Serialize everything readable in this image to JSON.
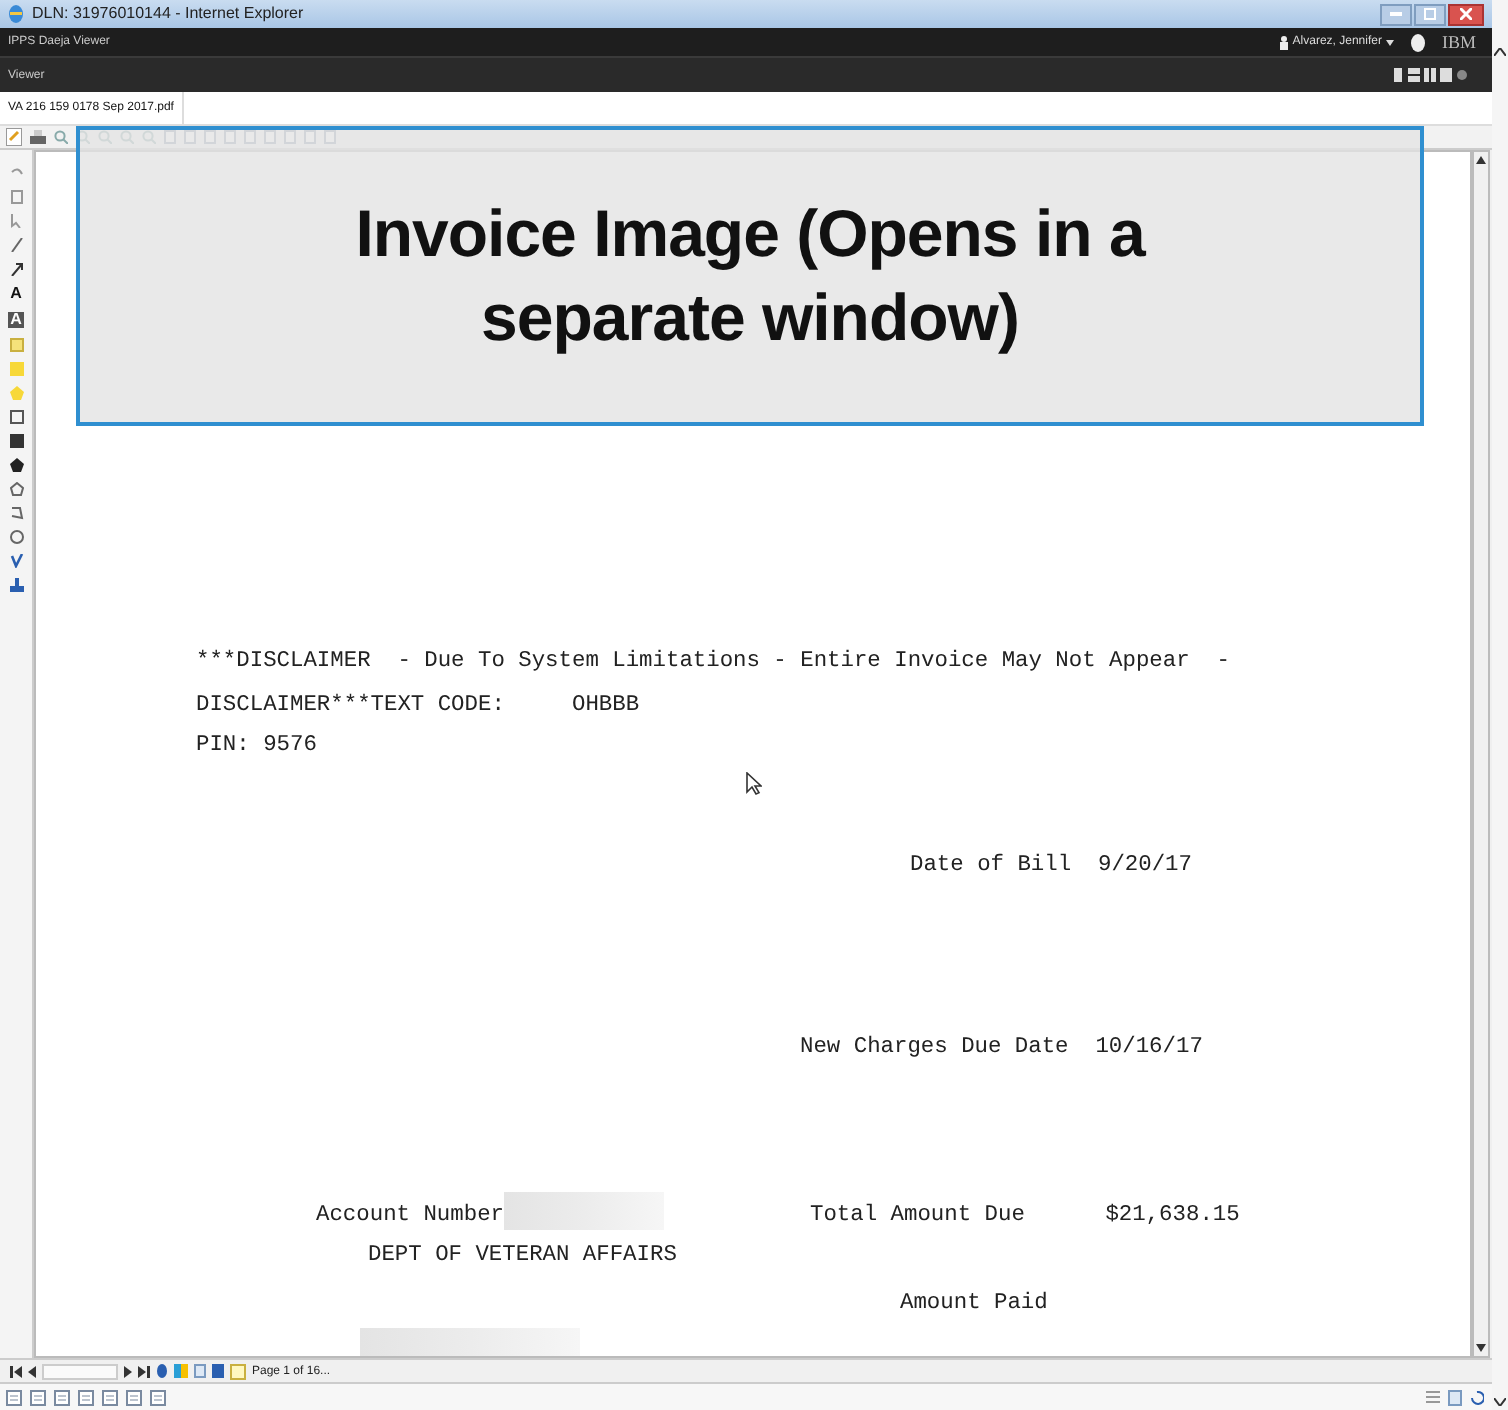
{
  "window": {
    "title": "DLN: 31976010144 - Internet Explorer"
  },
  "app_header": {
    "title": "IPPS Daeja Viewer",
    "user": "Alvarez, Jennifer",
    "brand": "IBM"
  },
  "view_bar": {
    "title": "Viewer"
  },
  "document_tab": {
    "label": "VA 216 159 0178 Sep 2017.pdf"
  },
  "tools": {
    "text_glyphs": [
      "A",
      "A"
    ]
  },
  "callout": {
    "text": "Invoice Image (Opens in a separate window)"
  },
  "document": {
    "lines": [
      {
        "text": "***DISCLAIMER  - Due To System Limitations - Entire Invoice May Not Appear  -"
      },
      {
        "text": "DISCLAIMER***TEXT CODE:     OHBBB"
      },
      {
        "text": "PIN: 9576"
      },
      {
        "text": "Date of Bill  9/20/17"
      },
      {
        "text": "New Charges Due Date  10/16/17"
      },
      {
        "text": "Account Number"
      },
      {
        "text": "Total Amount Due      $21,638.15"
      },
      {
        "text": "DEPT OF VETERAN AFFAIRS"
      },
      {
        "text": "Amount Paid"
      }
    ]
  },
  "page_nav": {
    "status": "Page 1 of 16..."
  }
}
